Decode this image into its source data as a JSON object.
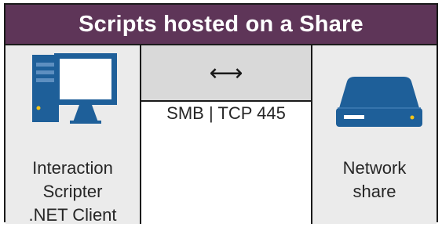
{
  "title": "Scripts hosted on a Share",
  "client": {
    "label_lines": [
      "Interaction",
      "Scripter",
      ".NET Client"
    ],
    "icon": "desktop-computer-icon"
  },
  "connection": {
    "arrow": "⟷",
    "protocol": "SMB | TCP 445"
  },
  "share": {
    "label_lines": [
      "Network",
      "share"
    ],
    "icon": "network-drive-icon"
  },
  "colors": {
    "title_bg": "#5e3558",
    "title_text": "#ffffff",
    "cell_bg": "#ebebeb",
    "arrow_cell_bg": "#d9d9d9",
    "icon_blue": "#1e5f99",
    "icon_white": "#ffffff",
    "led_yellow": "#f5c518"
  }
}
